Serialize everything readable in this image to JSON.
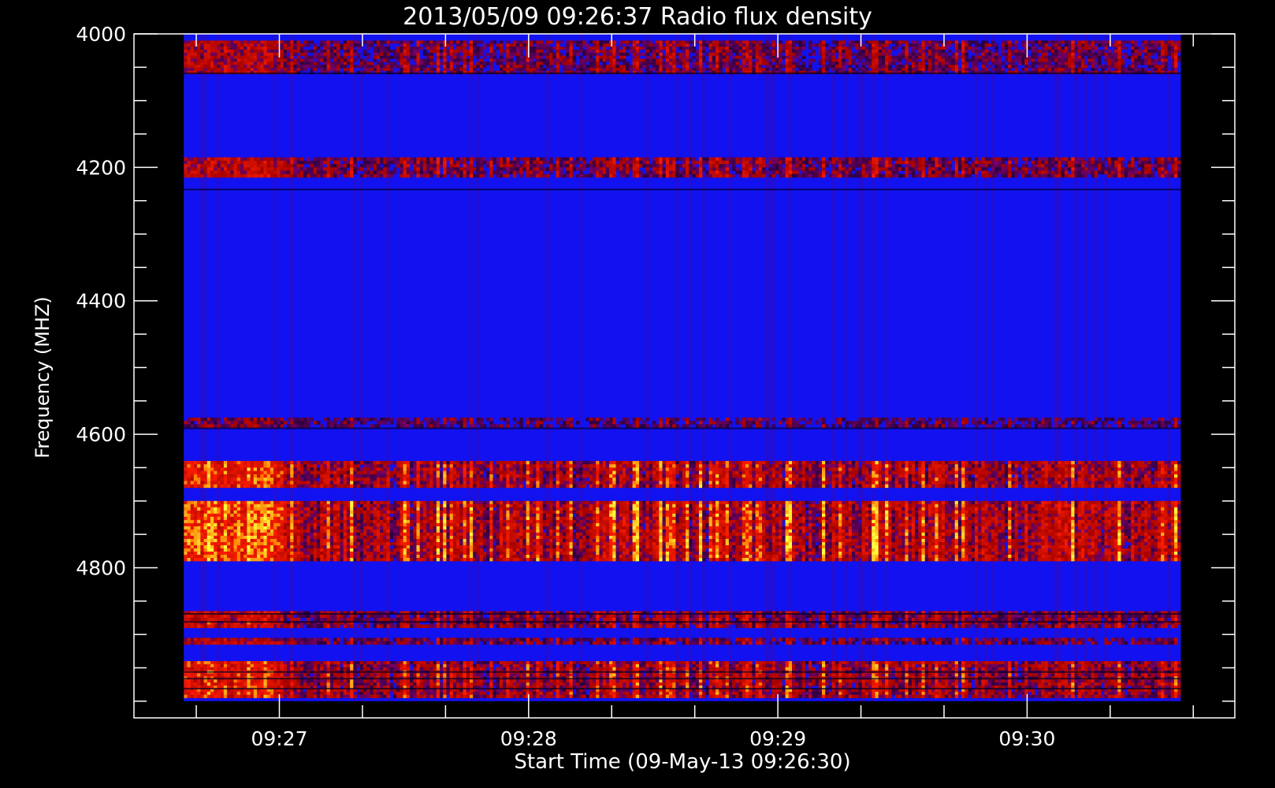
{
  "chart_data": {
    "type": "heatmap",
    "title": "2013/05/09 09:26:37 Radio flux density",
    "xlabel": "Start Time (09-May-13 09:26:30)",
    "ylabel": "Frequency (MHZ)",
    "y_axis": {
      "tick_labels": [
        "4000",
        "4200",
        "4400",
        "4600",
        "4800"
      ],
      "tick_values": [
        4000,
        4200,
        4400,
        4600,
        4800
      ],
      "minor_step": 50,
      "range": [
        4000,
        5025
      ],
      "inverted": true
    },
    "x_axis": {
      "tick_labels": [
        "09:27",
        "09:28",
        "09:29",
        "09:30"
      ],
      "tick_values_sec": [
        30,
        90,
        150,
        210
      ],
      "minor_step_sec": 20,
      "range_sec": [
        -5,
        260
      ]
    },
    "data_extent": {
      "time_start_sec": 7,
      "time_end_sec": 247,
      "freq_start": 4000,
      "freq_end": 5000
    },
    "colormap": [
      "#000000",
      "#0000ff",
      "#ff0000",
      "#ffff00"
    ],
    "background_level": "blue",
    "emission_bands_mhz": [
      {
        "from": 4010,
        "to": 4060,
        "intensity": 0.5
      },
      {
        "from": 4185,
        "to": 4215,
        "intensity": 0.55
      },
      {
        "from": 4575,
        "to": 4590,
        "intensity": 0.35
      },
      {
        "from": 4640,
        "to": 4680,
        "intensity": 0.8
      },
      {
        "from": 4700,
        "to": 4790,
        "intensity": 0.9
      },
      {
        "from": 4865,
        "to": 4890,
        "intensity": 0.6
      },
      {
        "from": 4905,
        "to": 4915,
        "intensity": 0.5
      },
      {
        "from": 4940,
        "to": 4995,
        "intensity": 0.75
      }
    ]
  }
}
